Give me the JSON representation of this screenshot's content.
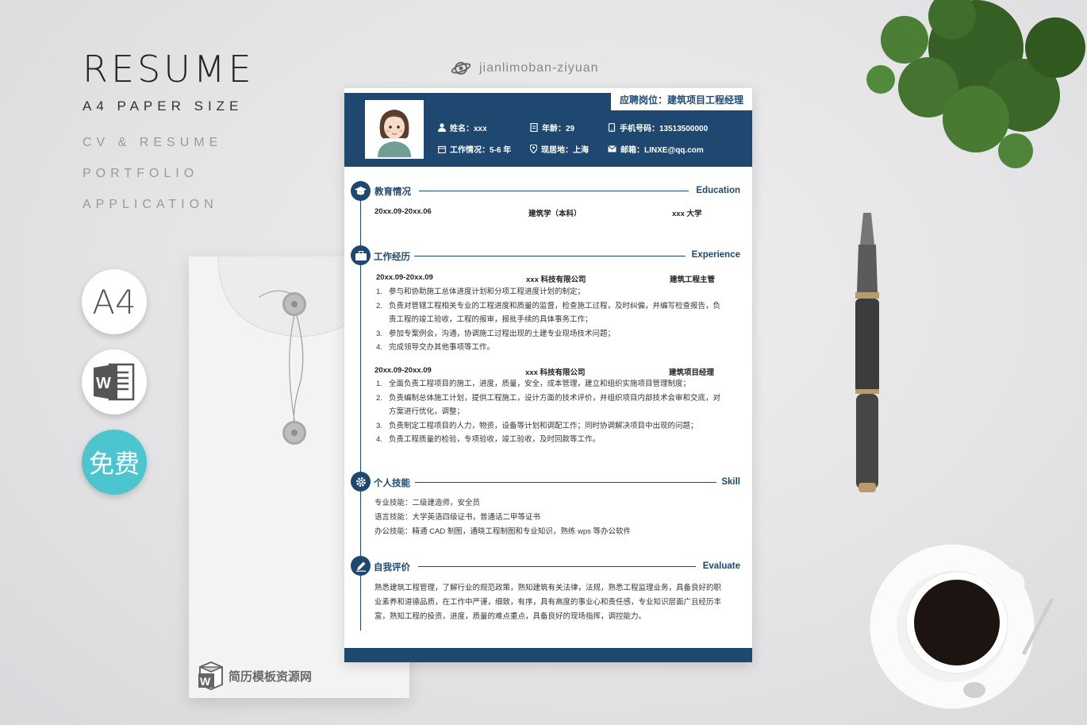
{
  "branding": {
    "title": "RESUME",
    "subtitle": "A4 PAPER SIZE",
    "tags": [
      "CV & RESUME",
      "PORTFOLIO",
      "APPLICATION"
    ],
    "badge_a4": "A4",
    "badge_free": "免费"
  },
  "watermark": "jianlimoban-ziyuan",
  "envelope_logo": "简历模板资源网",
  "resume": {
    "position": "应聘岗位：建筑项目工程经理",
    "info": {
      "name": "姓名：xxx",
      "age": "年龄：29",
      "phone": "手机号码：13513500000",
      "work": "工作情况：5-6 年",
      "location": "现居地：上海",
      "email": "邮箱：LINXE@qq.com"
    },
    "education": {
      "title": "教育情况",
      "en": "Education",
      "period": "20xx.09-20xx.06",
      "major": "建筑学（本科）",
      "school": "xxx 大学"
    },
    "experience": {
      "title": "工作经历",
      "en": "Experience",
      "jobs": [
        {
          "period": "20xx.09-20xx.09",
          "company": "xxx 科技有限公司",
          "role": "建筑工程主管",
          "items": [
            "参与和协助施工总体进度计划和分项工程进度计划的制定；",
            "负责对管辖工程相关专业的工程进度和质量的监督，检查施工过程，及时纠偏，并编写检查报告，负责工程的竣工验收，工程的报审，报批手续的具体事务工作；",
            "参加专案例会，沟通，协调施工过程出现的土建专业现场技术问题；",
            "完成领导交办其他事项等工作。"
          ]
        },
        {
          "period": "20xx.09-20xx.09",
          "company": "xxx 科技有限公司",
          "role": "建筑项目经理",
          "items": [
            "全面负责工程项目的施工，进度，质量，安全，成本管理，建立和组织实施项目管理制度；",
            "负责编制总体施工计划，提供工程施工，设计方面的技术评价，并组织项目内部技术会审和交底，对方案进行优化，调整；",
            "负责制定工程项目的人力，物资，设备等计划和调配工作；同时协调解决项目中出现的问题；",
            "负责工程质量的检验，专项验收，竣工验收，及时回款等工作。"
          ]
        }
      ]
    },
    "skills": {
      "title": "个人技能",
      "en": "Skill",
      "lines": [
        "专业技能：二级建造师，安全员",
        "语言技能：大学英语四级证书，普通话二甲等证书",
        "办公技能：精通 CAD 制图，通晓工程制图和专业知识，熟练 wps 等办公软件"
      ]
    },
    "evaluation": {
      "title": "自我评价",
      "en": "Evaluate",
      "text": "熟悉建筑工程管理，了解行业的规范政策，熟知建筑有关法律，法规，熟悉工程监理业务，具备良好的职业素养和道德品质，在工作中严谨，细致，有序，具有高度的事业心和责任感，专业知识层面广且经历丰富，熟知工程的投资，进度，质量的难点重点，具备良好的现场指挥，调控能力。"
    }
  },
  "colors": {
    "primary": "#1f4870",
    "free_badge": "#4dc5cf"
  },
  "icons": [
    "user-icon",
    "calendar-icon",
    "phone-icon",
    "briefcase-icon",
    "location-icon",
    "mail-icon",
    "graduation-cap-icon",
    "gear-icon",
    "pen-icon",
    "word-icon",
    "planet-icon"
  ]
}
